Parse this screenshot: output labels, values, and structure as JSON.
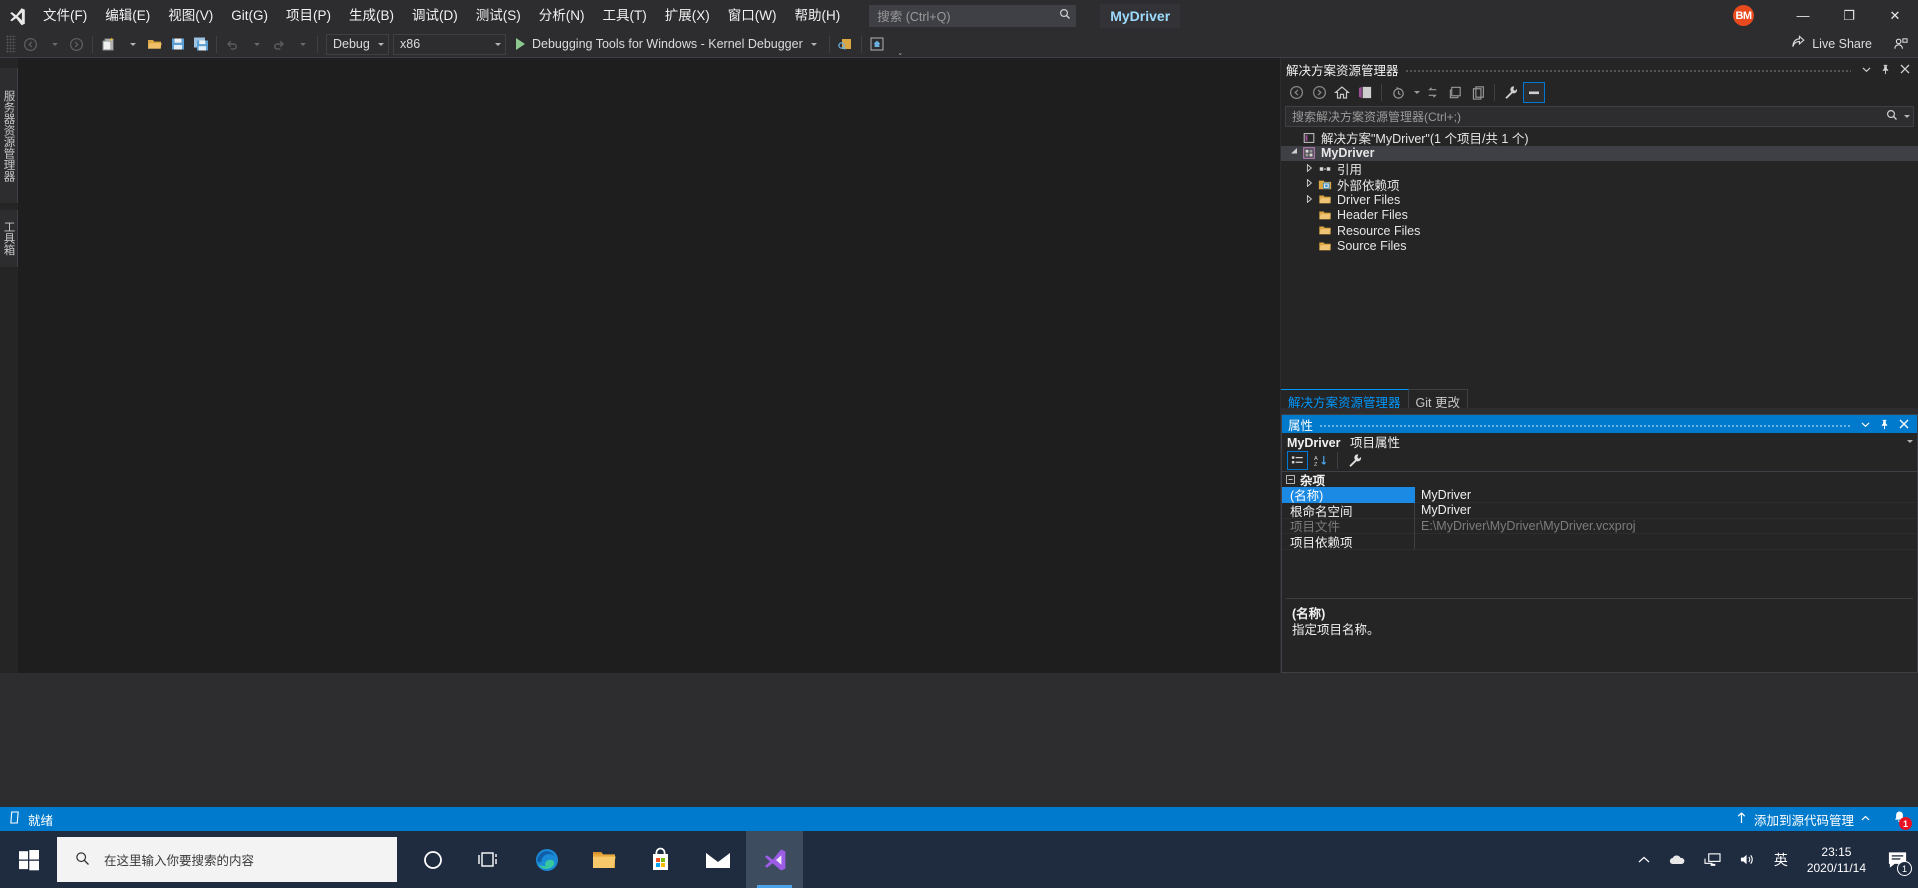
{
  "window": {
    "solution_name": "MyDriver",
    "avatar_initials": "BM"
  },
  "menu": {
    "items": [
      {
        "label": "文件(F)"
      },
      {
        "label": "编辑(E)"
      },
      {
        "label": "视图(V)"
      },
      {
        "label": "Git(G)"
      },
      {
        "label": "项目(P)"
      },
      {
        "label": "生成(B)"
      },
      {
        "label": "调试(D)"
      },
      {
        "label": "测试(S)"
      },
      {
        "label": "分析(N)"
      },
      {
        "label": "工具(T)"
      },
      {
        "label": "扩展(X)"
      },
      {
        "label": "窗口(W)"
      },
      {
        "label": "帮助(H)"
      }
    ],
    "search_placeholder": "搜索 (Ctrl+Q)"
  },
  "window_buttons": {
    "minimize": "—",
    "maximize": "❐",
    "close": "✕"
  },
  "toolbar": {
    "configuration": "Debug",
    "platform": "x86",
    "run_target": "Debugging Tools for Windows - Kernel Debugger",
    "live_share": "Live Share"
  },
  "left_dock": {
    "tabs": [
      {
        "label": "服务器资源管理器"
      },
      {
        "label": "工具箱"
      }
    ]
  },
  "solution_explorer": {
    "title": "解决方案资源管理器",
    "search_placeholder": "搜索解决方案资源管理器(Ctrl+;)",
    "tree": [
      {
        "label": "解决方案\"MyDriver\"(1 个项目/共 1 个)",
        "icon": "solution-icon",
        "indent": 0,
        "twisty": "",
        "bold": false,
        "selected": false
      },
      {
        "label": "MyDriver",
        "icon": "project-icon",
        "indent": 0,
        "twisty": "▲",
        "bold": true,
        "selected": true
      },
      {
        "label": "引用",
        "icon": "references-icon",
        "indent": 1,
        "twisty": "▶",
        "bold": false,
        "selected": false
      },
      {
        "label": "外部依赖项",
        "icon": "external-deps-icon",
        "indent": 1,
        "twisty": "▶",
        "bold": false,
        "selected": false
      },
      {
        "label": "Driver Files",
        "icon": "folder-icon",
        "indent": 1,
        "twisty": "▶",
        "bold": false,
        "selected": false
      },
      {
        "label": "Header Files",
        "icon": "folder-icon",
        "indent": 1,
        "twisty": "",
        "bold": false,
        "selected": false
      },
      {
        "label": "Resource Files",
        "icon": "folder-icon",
        "indent": 1,
        "twisty": "",
        "bold": false,
        "selected": false
      },
      {
        "label": "Source Files",
        "icon": "folder-icon",
        "indent": 1,
        "twisty": "",
        "bold": false,
        "selected": false
      }
    ],
    "tabs": [
      {
        "label": "解决方案资源管理器",
        "active": true
      },
      {
        "label": "Git 更改",
        "active": false
      }
    ]
  },
  "properties": {
    "title": "属性",
    "object_name": "MyDriver",
    "object_type": "项目属性",
    "category": "杂项",
    "rows": [
      {
        "name": "(名称)",
        "value": "MyDriver",
        "selected": true,
        "disabled": false
      },
      {
        "name": "根命名空间",
        "value": "MyDriver",
        "selected": false,
        "disabled": false
      },
      {
        "name": "项目文件",
        "value": "E:\\MyDriver\\MyDriver\\MyDriver.vcxproj",
        "selected": false,
        "disabled": true
      },
      {
        "name": "项目依赖项",
        "value": "",
        "selected": false,
        "disabled": false
      }
    ],
    "description_title": "(名称)",
    "description_text": "指定项目名称。"
  },
  "status_bar": {
    "state": "就绪",
    "source_control": "添加到源代码管理",
    "notification_count": "1"
  },
  "taskbar": {
    "search_placeholder": "在这里输入你要搜索的内容",
    "time": "23:15",
    "date": "2020/11/14",
    "ime": "英",
    "notification_count": "1",
    "apps": [
      {
        "name": "cortana-icon"
      },
      {
        "name": "task-view-icon"
      },
      {
        "name": "edge-icon"
      },
      {
        "name": "file-explorer-icon"
      },
      {
        "name": "microsoft-store-icon"
      },
      {
        "name": "mail-icon"
      },
      {
        "name": "visual-studio-icon"
      }
    ]
  },
  "colors": {
    "accent": "#007acc",
    "selection": "#1a8ae5",
    "chrome": "#2d2d30",
    "editor": "#1e1e1e",
    "panel": "#252526",
    "taskbar": "#1f2c40"
  }
}
